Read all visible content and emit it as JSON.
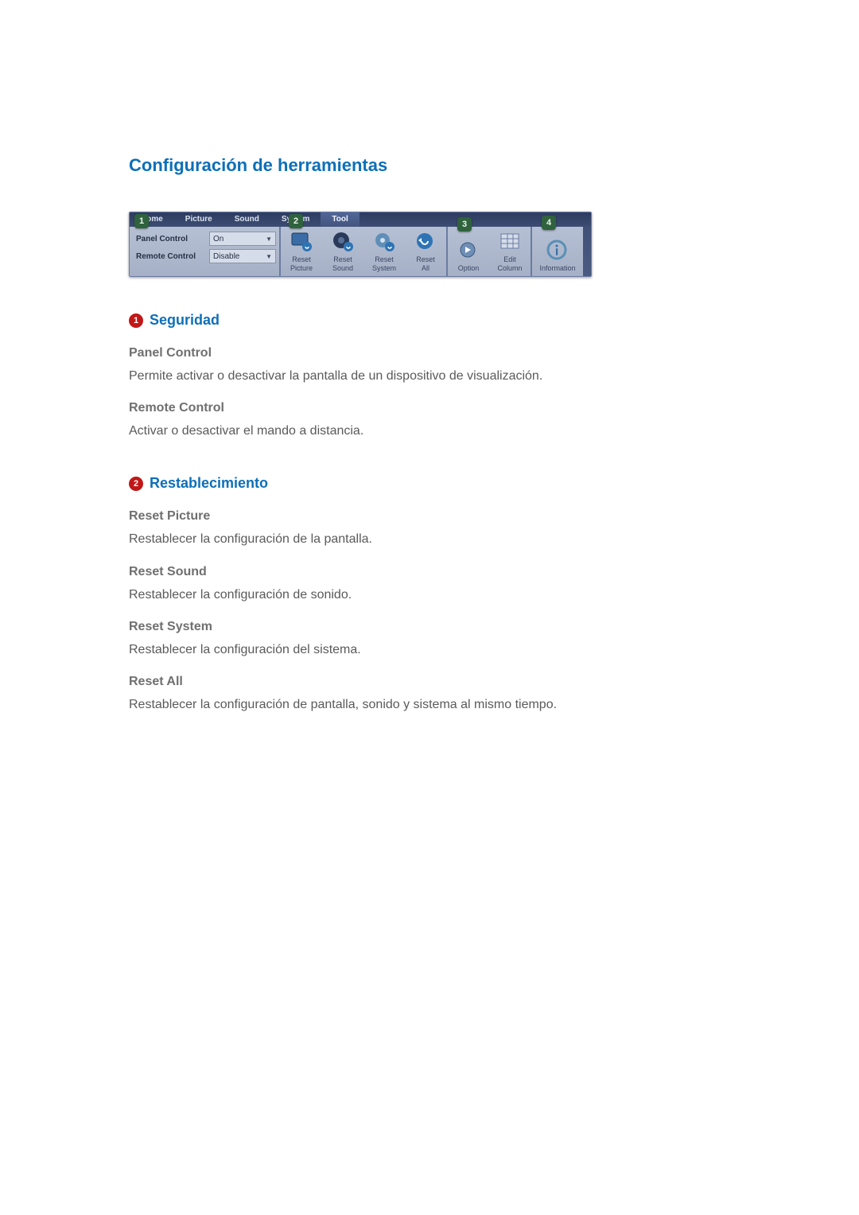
{
  "title": "Configuración de herramientas",
  "toolbar": {
    "tabs": [
      "Home",
      "Picture",
      "Sound",
      "System",
      "Tool"
    ],
    "security": {
      "panel_control_label": "Panel Control",
      "panel_control_value": "On",
      "remote_control_label": "Remote Control",
      "remote_control_value": "Disable"
    },
    "reset_buttons": [
      {
        "label": "Reset\nPicture"
      },
      {
        "label": "Reset\nSound"
      },
      {
        "label": "Reset\nSystem"
      },
      {
        "label": "Reset\nAll"
      }
    ],
    "option_buttons": [
      {
        "label": "Option"
      },
      {
        "label": "Edit\nColumn"
      }
    ],
    "info_button": {
      "label": "Information"
    },
    "callouts": [
      "1",
      "2",
      "3",
      "4"
    ]
  },
  "sections": [
    {
      "num": "1",
      "heading": "Seguridad",
      "items": [
        {
          "title": "Panel Control",
          "desc": "Permite activar o desactivar la pantalla de un dispositivo de visualización."
        },
        {
          "title": "Remote Control",
          "desc": "Activar o desactivar el mando a distancia."
        }
      ]
    },
    {
      "num": "2",
      "heading": "Restablecimiento",
      "items": [
        {
          "title": "Reset Picture",
          "desc": "Restablecer la configuración de la pantalla."
        },
        {
          "title": "Reset Sound",
          "desc": "Restablecer la configuración de sonido."
        },
        {
          "title": "Reset System",
          "desc": "Restablecer la configuración del sistema."
        },
        {
          "title": "Reset All",
          "desc": "Restablecer la configuración de pantalla, sonido y sistema al mismo tiempo."
        }
      ]
    }
  ]
}
